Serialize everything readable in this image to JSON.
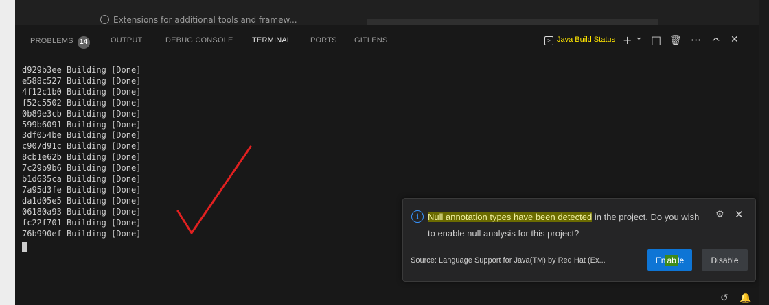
{
  "editor_top": {
    "item_label": "Extensions for additional tools and framew..."
  },
  "panel": {
    "tabs": [
      {
        "label": "PROBLEMS",
        "badge": "14"
      },
      {
        "label": "OUTPUT"
      },
      {
        "label": "DEBUG CONSOLE"
      },
      {
        "label": "TERMINAL",
        "active": true
      },
      {
        "label": "PORTS"
      },
      {
        "label": "GITLENS"
      }
    ],
    "status_button": "Java Build Status",
    "actions": {
      "add": "+",
      "dropdown": "⌄",
      "split": "◫",
      "trash": "🗑",
      "more": "···",
      "maximize": "^",
      "close": "✕"
    }
  },
  "terminal": {
    "lines": [
      "d929b3ee Building [Done]",
      "e588c527 Building [Done]",
      "4f12c1b0 Building [Done]",
      "f52c5502 Building [Done]",
      "0b89e3cb Building [Done]",
      "599b6091 Building [Done]",
      "3df054be Building [Done]",
      "c907d91c Building [Done]",
      "8cb1e62b Building [Done]",
      "7c29b9b6 Building [Done]",
      "b1d635ca Building [Done]",
      "7a95d3fe Building [Done]",
      "da1d05e5 Building [Done]",
      "06180a93 Building [Done]",
      "fc22f701 Building [Done]",
      "76b990ef Building [Done]"
    ]
  },
  "notification": {
    "message_highlight": "Null annotation types have been detected",
    "message_rest": " in the project. Do you wish to enable null analysis for this project?",
    "source": "Source: Language Support for Java(TM) by Red Hat (Ex...",
    "enable_label_a": "En",
    "enable_label_b": "ab",
    "enable_label_c": "le",
    "disable_label": "Disable"
  },
  "colors": {
    "accent": "#0e75d5",
    "status_yellow": "#ffe600",
    "annotation_red": "#e02020"
  }
}
